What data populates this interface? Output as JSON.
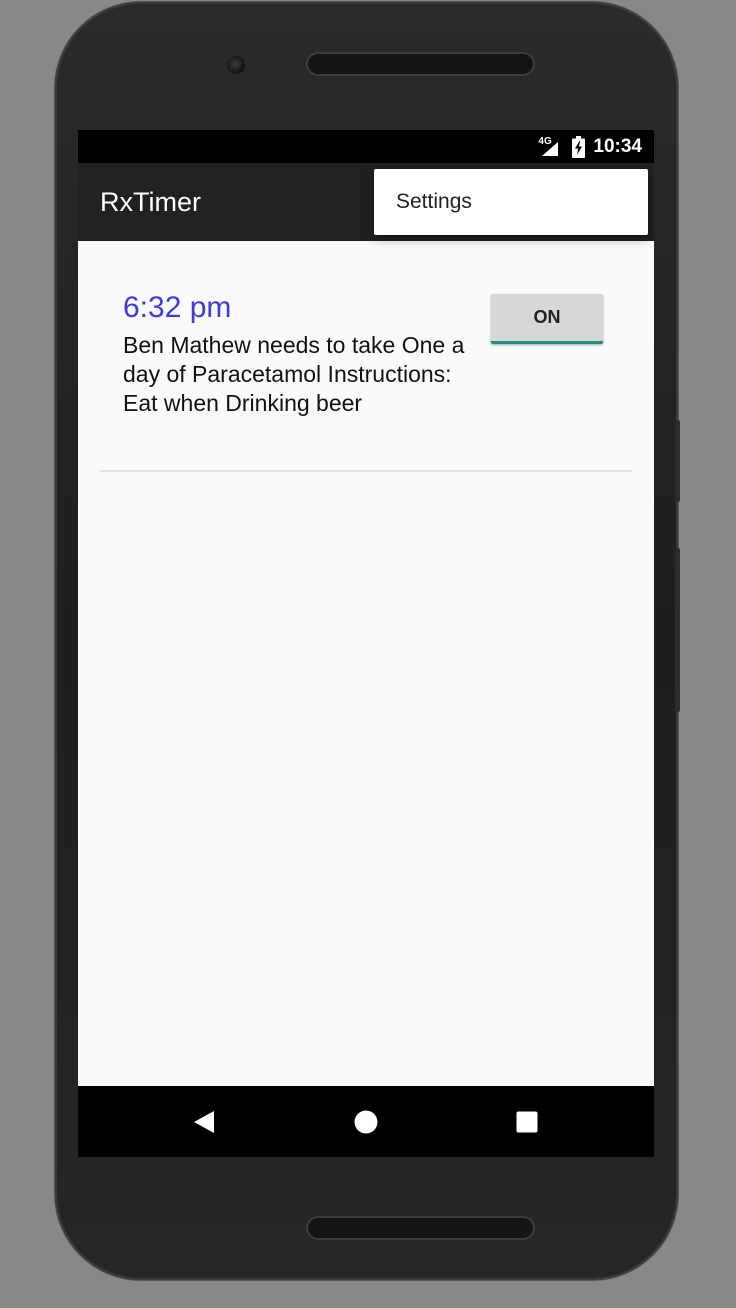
{
  "status_bar": {
    "network": "4G",
    "time": "10:34"
  },
  "app_bar": {
    "title": "RxTimer"
  },
  "overflow_menu": {
    "items": [
      {
        "label": "Settings"
      }
    ]
  },
  "reminders": [
    {
      "time": "6:32 pm",
      "description": "Ben Mathew needs to take One a day of Paracetamol Instructions: Eat when Drinking beer",
      "toggle_label": "ON"
    }
  ],
  "nav_bar": {
    "icons": [
      "back-icon",
      "home-icon",
      "recents-icon"
    ]
  },
  "colors": {
    "app_bar": "#212121",
    "time_accent": "#3a3ce0",
    "toggle_underline": "#22907e",
    "background": "#fafafa"
  }
}
